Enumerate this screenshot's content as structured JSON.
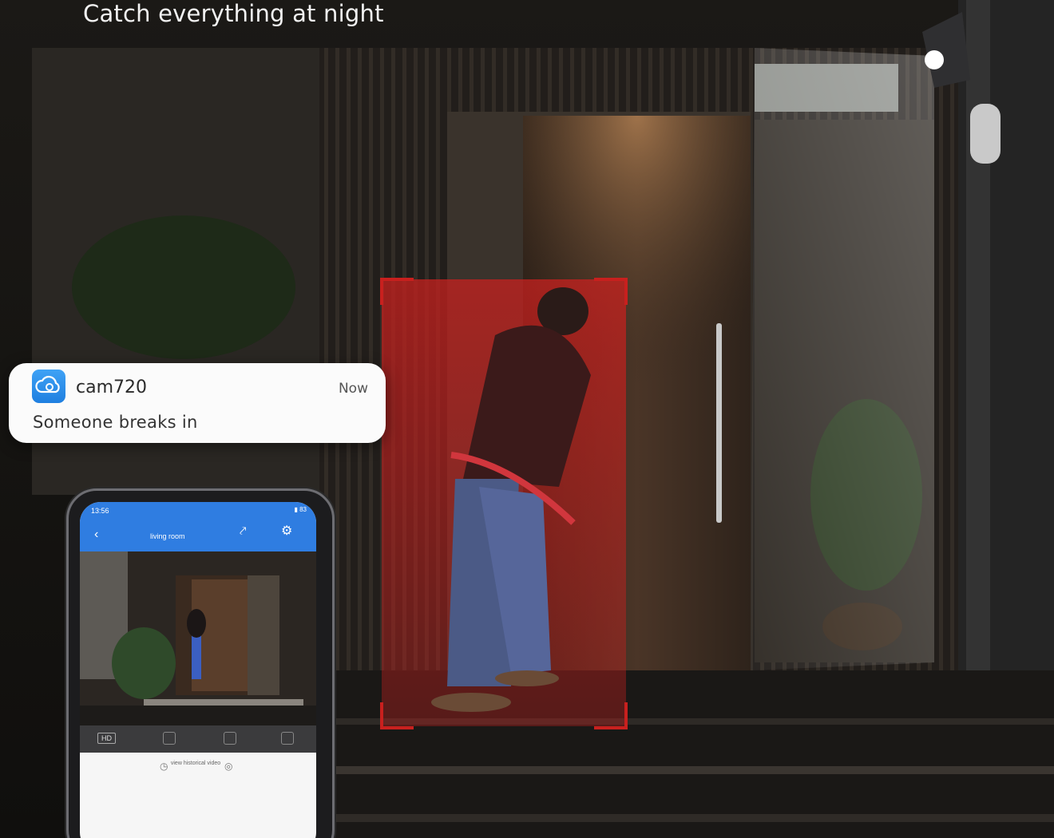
{
  "headline": "Catch everything at night",
  "notification": {
    "app_name": "cam720",
    "time": "Now",
    "message": "Someone breaks in",
    "icon": "cloud-camera-icon"
  },
  "phone": {
    "status_time": "13:56",
    "status_battery": "83",
    "camera_name": "living room",
    "share_label": "share",
    "settings_label": "settings",
    "quality_label": "HD",
    "history_label": "view historical video"
  },
  "colors": {
    "detection_red": "#c8201e",
    "app_blue": "#2f7de1"
  }
}
